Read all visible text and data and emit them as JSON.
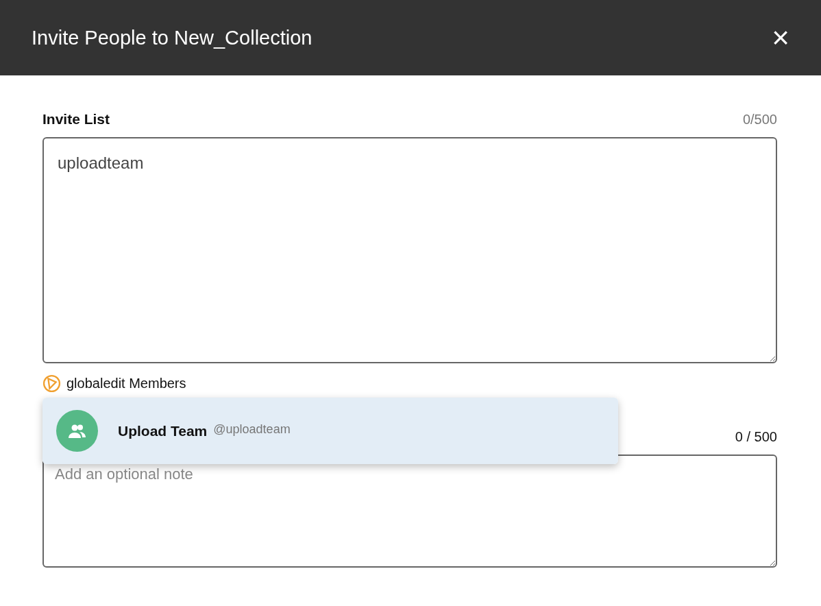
{
  "dialog": {
    "title": "Invite People to New_Collection",
    "close": "×"
  },
  "invite_list": {
    "label": "Invite List",
    "count": "0/500",
    "value": "uploadteam"
  },
  "org": {
    "name": "globaledit Members"
  },
  "suggestions": [
    {
      "name": "Upload Team",
      "handle": "@uploadteam",
      "selected": true
    }
  ],
  "note": {
    "count": "0 / 500",
    "placeholder": "Add an optional note"
  }
}
